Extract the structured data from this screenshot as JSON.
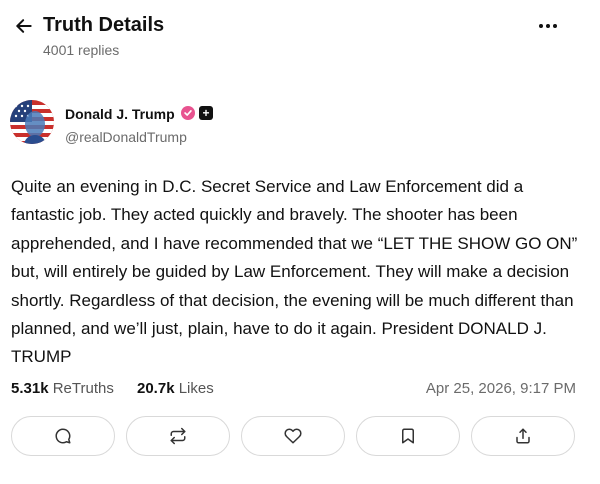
{
  "header": {
    "back_icon": "arrow-left-icon",
    "title": "Truth Details",
    "replies": "4001 replies",
    "more_icon": "more-horizontal-icon"
  },
  "author": {
    "name": "Donald J. Trump",
    "handle": "@realDonaldTrump",
    "verified_icon": "verified-check-icon",
    "verified_color": "#e8538f",
    "plus_badge": "+"
  },
  "post": {
    "text": "Quite an evening in D.C. Secret Service and Law Enforcement did a fantastic job. They acted quickly and bravely. The shooter has been apprehended, and I have recommended that we “LET THE SHOW GO ON” but, will entirely be guided by Law Enforcement. They will make a decision shortly. Regardless of that decision, the evening will be much different than planned, and we’ll just, plain, have to do it again. President DONALD J. TRUMP"
  },
  "stats": {
    "retruths_count": "5.31k",
    "retruths_label": "ReTruths",
    "likes_count": "20.7k",
    "likes_label": "Likes",
    "timestamp": "Apr 25, 2026, 9:17 PM"
  },
  "actions": [
    {
      "icon": "reply-icon"
    },
    {
      "icon": "retruth-icon"
    },
    {
      "icon": "like-heart-icon"
    },
    {
      "icon": "bookmark-icon"
    },
    {
      "icon": "share-icon"
    }
  ]
}
